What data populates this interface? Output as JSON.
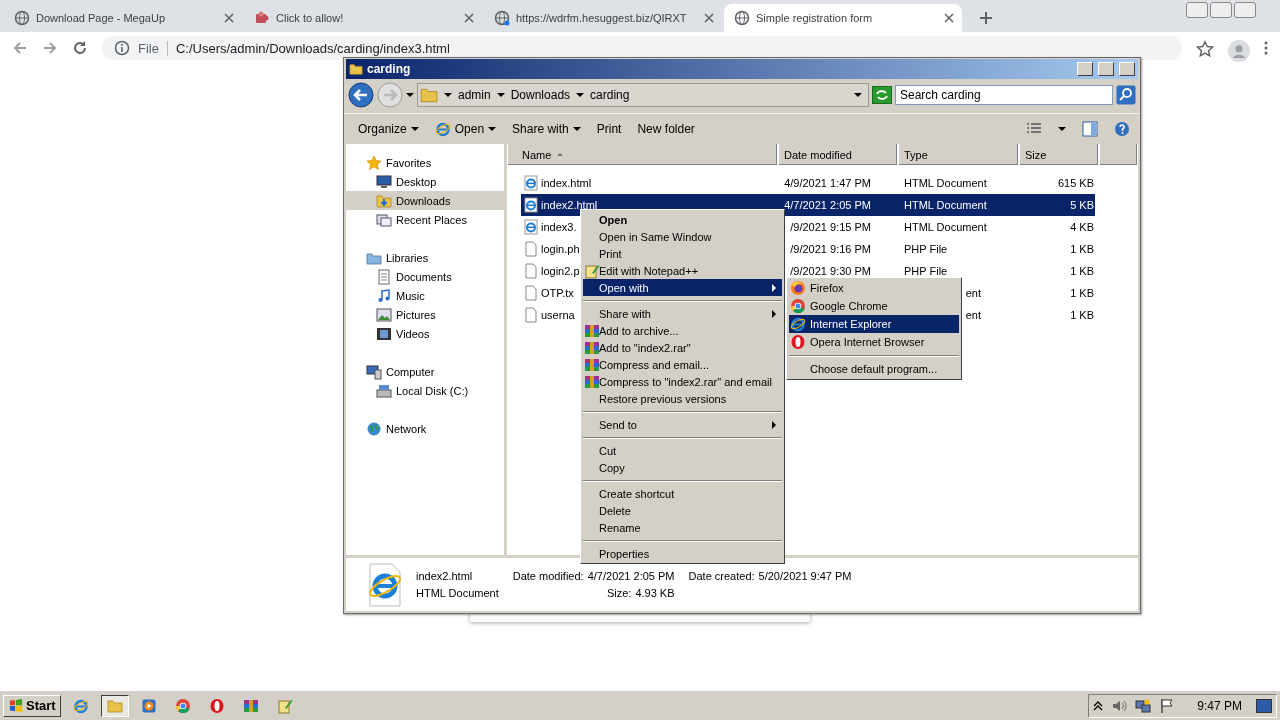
{
  "browser": {
    "tabs": [
      {
        "title": "Download Page - MegaUp",
        "kind": "site",
        "selected": false
      },
      {
        "title": "Click to allow!",
        "kind": "alert",
        "selected": false
      },
      {
        "title": "https://wdrfm.hesuggest.biz/QIRXT",
        "kind": "loading",
        "selected": false
      },
      {
        "title": "Simple registration form",
        "kind": "site",
        "selected": true
      }
    ],
    "address": {
      "scheme": "File",
      "value": "C:/Users/admin/Downloads/carding/index3.html"
    }
  },
  "explorer": {
    "title": "carding",
    "breadcrumb": [
      "admin",
      "Downloads",
      "carding"
    ],
    "search": {
      "placeholder": "Search carding"
    },
    "toolbar": [
      {
        "label": "Organize",
        "dropdown": true
      },
      {
        "label": "Open",
        "dropdown": true
      },
      {
        "label": "Share with",
        "dropdown": true
      },
      {
        "label": "Print",
        "dropdown": false
      },
      {
        "label": "New folder",
        "dropdown": false
      }
    ],
    "nav": [
      {
        "label": "Favorites",
        "selected": false,
        "children": [
          {
            "label": "Desktop",
            "selected": false
          },
          {
            "label": "Downloads",
            "selected": true
          },
          {
            "label": "Recent Places",
            "selected": false
          }
        ]
      },
      {
        "label": "Libraries",
        "selected": false,
        "children": [
          {
            "label": "Documents",
            "selected": false
          },
          {
            "label": "Music",
            "selected": false
          },
          {
            "label": "Pictures",
            "selected": false
          },
          {
            "label": "Videos",
            "selected": false
          }
        ]
      },
      {
        "label": "Computer",
        "selected": false,
        "children": [
          {
            "label": "Local Disk (C:)",
            "selected": false
          }
        ]
      },
      {
        "label": "Network",
        "selected": false
      }
    ],
    "columns": [
      {
        "label": "Name",
        "sorted": true
      },
      {
        "label": "Date modified",
        "sorted": false
      },
      {
        "label": "Type",
        "sorted": false
      },
      {
        "label": "Size",
        "sorted": false
      }
    ],
    "rows": [
      {
        "kind": "html",
        "name": "index.html",
        "date": "4/9/2021 1:47 PM",
        "type": "HTML Document",
        "size": "615 KB",
        "selected": false
      },
      {
        "kind": "html",
        "name": "index2.html",
        "date": "4/7/2021 2:05 PM",
        "type": "HTML Document",
        "size": "5 KB",
        "selected": true
      },
      {
        "kind": "html",
        "name": "index3.",
        "date": "/9/2021 9:15 PM",
        "type": "HTML Document",
        "size": "4 KB",
        "selected": false
      },
      {
        "kind": "file",
        "name": "login.ph",
        "date": "/9/2021 9:16 PM",
        "type": "PHP File",
        "size": "1 KB",
        "selected": false
      },
      {
        "kind": "file",
        "name": "login2.p",
        "date": "/9/2021 9:30 PM",
        "type": "PHP File",
        "size": "1 KB",
        "selected": false
      },
      {
        "kind": "file",
        "name": "OTP.tx",
        "type": "ent",
        "size": "1 KB",
        "selected": false
      },
      {
        "kind": "file",
        "name": "userna",
        "type": "ent",
        "size": "1 KB",
        "selected": false
      }
    ],
    "details": {
      "name": "index2.html",
      "type": "HTML Document",
      "fields": [
        {
          "label": "Date modified:",
          "value": "4/7/2021 2:05 PM"
        },
        {
          "label": "Date created:",
          "value": "5/20/2021 9:47 PM"
        },
        {
          "label": "Size:",
          "value": "4.93 KB"
        }
      ]
    }
  },
  "context_menu": [
    {
      "kind": "default",
      "label": "Open",
      "submenu": false,
      "selected": false
    },
    {
      "kind": "item",
      "label": "Open in Same Window",
      "submenu": false,
      "selected": false
    },
    {
      "kind": "item",
      "label": "Print",
      "submenu": false,
      "selected": false
    },
    {
      "kind": "item",
      "label": "Edit with Notepad++",
      "submenu": false,
      "selected": false
    },
    {
      "kind": "item",
      "label": "Open with",
      "submenu": true,
      "selected": true
    },
    {
      "kind": "separator"
    },
    {
      "kind": "item",
      "label": "Share with",
      "submenu": true,
      "selected": false
    },
    {
      "kind": "item",
      "label": "Add to archive...",
      "submenu": false,
      "selected": false
    },
    {
      "kind": "item",
      "label": "Add to \"index2.rar\"",
      "submenu": false,
      "selected": false
    },
    {
      "kind": "item",
      "label": "Compress and email...",
      "submenu": false,
      "selected": false
    },
    {
      "kind": "item",
      "label": "Compress to \"index2.rar\" and email",
      "submenu": false,
      "selected": false
    },
    {
      "kind": "item",
      "label": "Restore previous versions",
      "submenu": false,
      "selected": false
    },
    {
      "kind": "separator"
    },
    {
      "kind": "item",
      "label": "Send to",
      "submenu": true,
      "selected": false
    },
    {
      "kind": "separator"
    },
    {
      "kind": "item",
      "label": "Cut",
      "submenu": false,
      "selected": false
    },
    {
      "kind": "item",
      "label": "Copy",
      "submenu": false,
      "selected": false
    },
    {
      "kind": "separator"
    },
    {
      "kind": "item",
      "label": "Create shortcut",
      "submenu": false,
      "selected": false
    },
    {
      "kind": "item",
      "label": "Delete",
      "submenu": false,
      "selected": false
    },
    {
      "kind": "item",
      "label": "Rename",
      "submenu": false,
      "selected": false
    },
    {
      "kind": "separator"
    },
    {
      "kind": "item",
      "label": "Properties",
      "submenu": false,
      "selected": false
    }
  ],
  "open_with_menu": [
    {
      "kind": "item",
      "label": "Firefox",
      "selected": false
    },
    {
      "kind": "item",
      "label": "Google Chrome",
      "selected": false
    },
    {
      "kind": "item",
      "label": "Internet Explorer",
      "selected": true
    },
    {
      "kind": "item",
      "label": "Opera Internet Browser",
      "selected": false
    },
    {
      "kind": "separator"
    },
    {
      "kind": "item",
      "label": "Choose default program...",
      "selected": false
    }
  ],
  "taskbar": {
    "start": "Start",
    "apps": [
      {
        "selected": false
      },
      {
        "selected": true
      },
      {
        "selected": false
      },
      {
        "selected": false
      },
      {
        "selected": false
      },
      {
        "selected": false
      },
      {
        "selected": false
      }
    ],
    "clock": "9:47 PM"
  }
}
